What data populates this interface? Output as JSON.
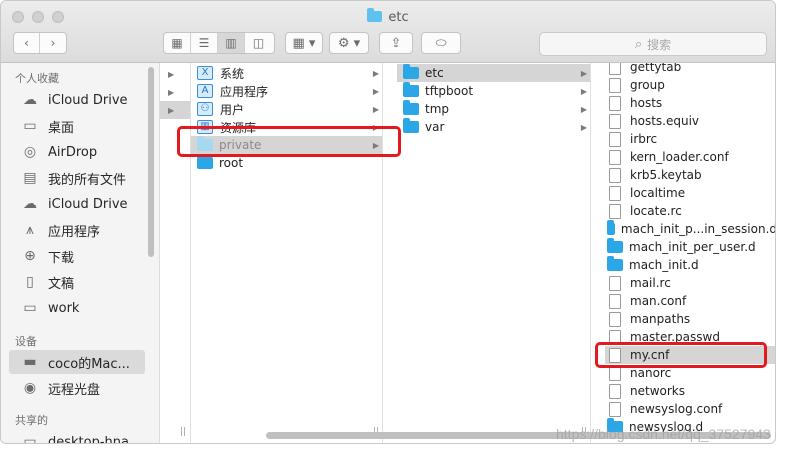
{
  "window": {
    "title": "etc"
  },
  "toolbar": {
    "back_icon": "chevron-left-icon",
    "forward_icon": "chevron-right-icon",
    "view_modes": [
      "icon-view-icon",
      "list-view-icon",
      "column-view-icon",
      "gallery-view-icon"
    ],
    "group_icon": "group-icon",
    "action_icon": "gear-icon",
    "share_icon": "share-icon",
    "tag_icon": "tag-icon",
    "search_placeholder": "搜索"
  },
  "sidebar": {
    "favorites_header": "个人收藏",
    "favorites": [
      {
        "label": "iCloud Drive",
        "icon": "cloud-icon"
      },
      {
        "label": "桌面",
        "icon": "desktop-icon"
      },
      {
        "label": "AirDrop",
        "icon": "airdrop-icon"
      },
      {
        "label": "我的所有文件",
        "icon": "all-files-icon"
      },
      {
        "label": "iCloud Drive",
        "icon": "cloud-icon"
      },
      {
        "label": "应用程序",
        "icon": "applications-icon"
      },
      {
        "label": "下载",
        "icon": "download-icon"
      },
      {
        "label": "文稿",
        "icon": "documents-icon"
      },
      {
        "label": "work",
        "icon": "folder-icon"
      }
    ],
    "devices_header": "设备",
    "devices": [
      {
        "label": "coco的Mac...",
        "icon": "laptop-icon"
      },
      {
        "label": "远程光盘",
        "icon": "disc-icon"
      }
    ],
    "shared_header": "共享的",
    "shared": [
      {
        "label": "desktop-hna",
        "icon": "pc-icon"
      }
    ]
  },
  "column1": {
    "items": [
      "",
      "",
      ""
    ]
  },
  "column2": {
    "items": [
      {
        "label": "系统",
        "icon": "system-folder-icon"
      },
      {
        "label": "应用程序",
        "icon": "applications-folder-icon"
      },
      {
        "label": "用户",
        "icon": "users-folder-icon"
      },
      {
        "label": "资源库",
        "icon": "library-folder-icon"
      },
      {
        "label": "private",
        "icon": "folder-icon"
      },
      {
        "label": "root",
        "icon": "folder-icon"
      }
    ]
  },
  "column3": {
    "items": [
      {
        "label": "etc"
      },
      {
        "label": "tftpboot"
      },
      {
        "label": "tmp"
      },
      {
        "label": "var"
      }
    ]
  },
  "column4": {
    "items": [
      {
        "label": "gettytab",
        "kind": "file"
      },
      {
        "label": "group",
        "kind": "file"
      },
      {
        "label": "hosts",
        "kind": "file"
      },
      {
        "label": "hosts.equiv",
        "kind": "file"
      },
      {
        "label": "irbrc",
        "kind": "file"
      },
      {
        "label": "kern_loader.conf",
        "kind": "file"
      },
      {
        "label": "krb5.keytab",
        "kind": "file"
      },
      {
        "label": "localtime",
        "kind": "file"
      },
      {
        "label": "locate.rc",
        "kind": "file"
      },
      {
        "label": "mach_init_p...in_session.d",
        "kind": "folder"
      },
      {
        "label": "mach_init_per_user.d",
        "kind": "folder"
      },
      {
        "label": "mach_init.d",
        "kind": "folder"
      },
      {
        "label": "mail.rc",
        "kind": "file"
      },
      {
        "label": "man.conf",
        "kind": "file"
      },
      {
        "label": "manpaths",
        "kind": "file"
      },
      {
        "label": "master.passwd",
        "kind": "file"
      },
      {
        "label": "my.cnf",
        "kind": "file"
      },
      {
        "label": "nanorc",
        "kind": "file"
      },
      {
        "label": "networks",
        "kind": "file"
      },
      {
        "label": "newsyslog.conf",
        "kind": "file"
      },
      {
        "label": "newsyslog.d",
        "kind": "folder"
      }
    ]
  },
  "watermark": "https://blog.csdn.net/qq_37527943",
  "colors": {
    "folder": "#2ba7e8",
    "highlight": "#e3191f",
    "selection": "#d5d5d5"
  }
}
